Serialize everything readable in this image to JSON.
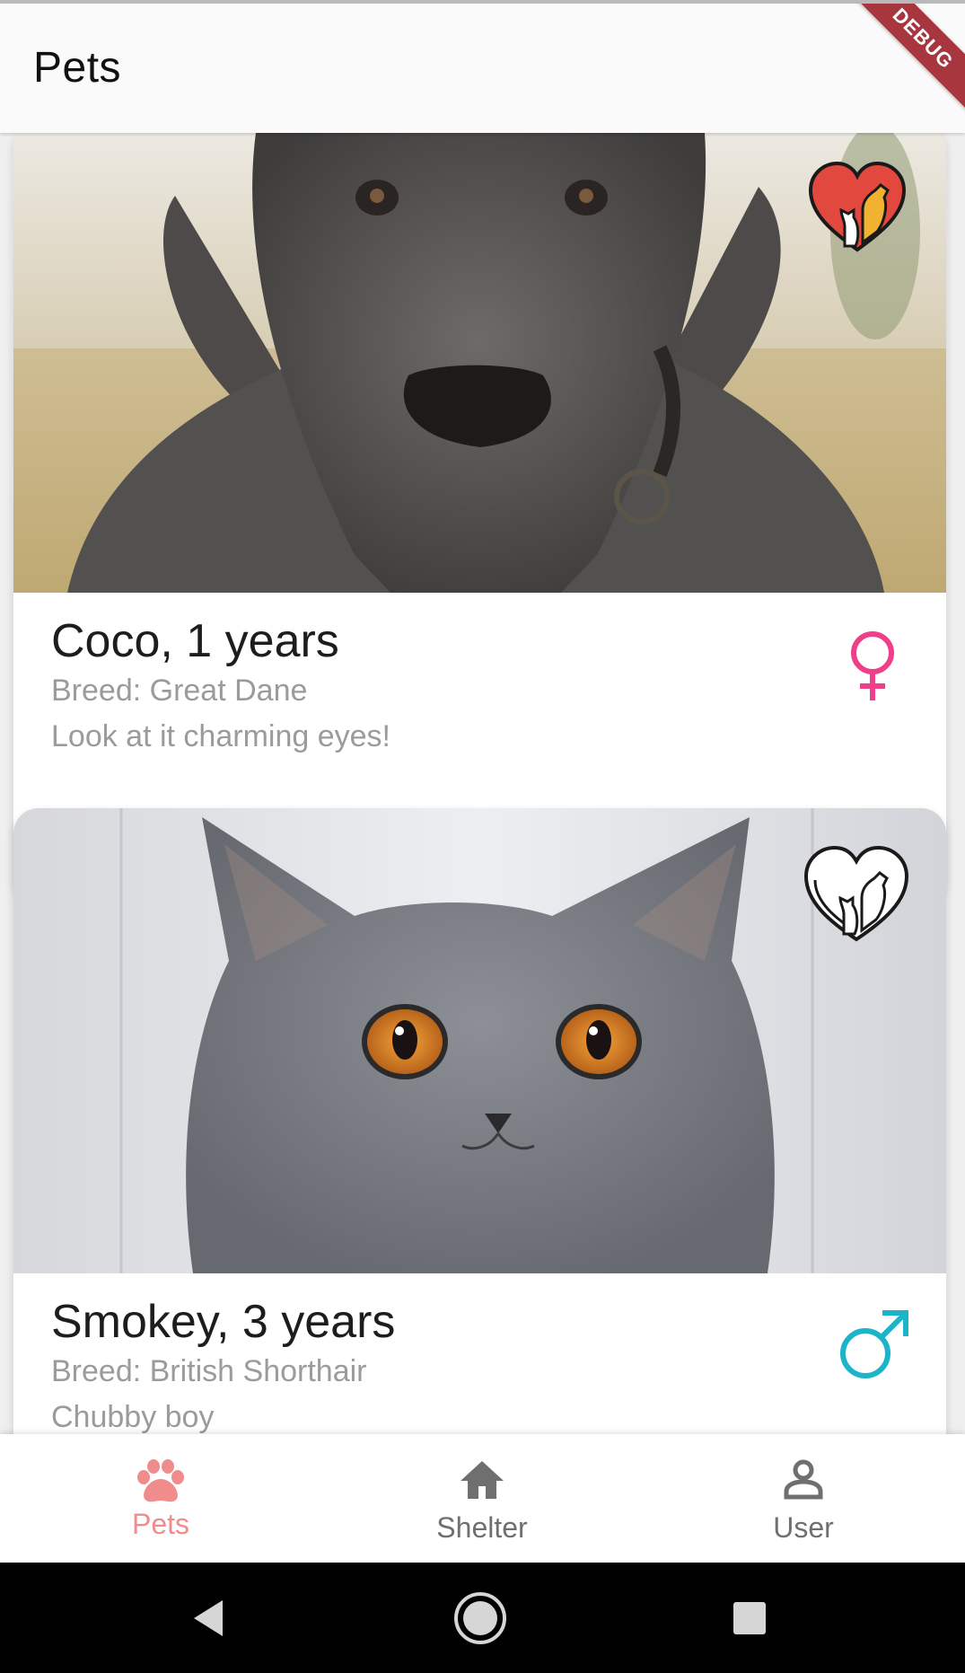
{
  "app_bar": {
    "title": "Pets",
    "debug_banner": "DEBUG"
  },
  "pets": [
    {
      "name_age": "Coco, 1 years",
      "breed": "Breed: Great Dane",
      "description": "Look at it charming eyes!",
      "sex": "female",
      "favorite": true,
      "photo": "great-dane-photo"
    },
    {
      "name_age": "Smokey, 3 years",
      "breed": "Breed: British Shorthair",
      "description": "Chubby boy",
      "sex": "male",
      "favorite": false,
      "photo": "british-shorthair-photo"
    }
  ],
  "bottom_nav": {
    "items": [
      {
        "label": "Pets",
        "icon": "paw-icon",
        "active": true
      },
      {
        "label": "Shelter",
        "icon": "home-icon",
        "active": false
      },
      {
        "label": "User",
        "icon": "person-icon",
        "active": false
      }
    ]
  },
  "colors": {
    "active": "#f08c8c",
    "inactive": "#6f6f6f",
    "female": "#ef3f8b",
    "male": "#1bb4c8",
    "heart_fill": "#e2483d"
  },
  "system_nav": {
    "icons": [
      "back-icon",
      "home-circle-icon",
      "recents-icon"
    ]
  }
}
